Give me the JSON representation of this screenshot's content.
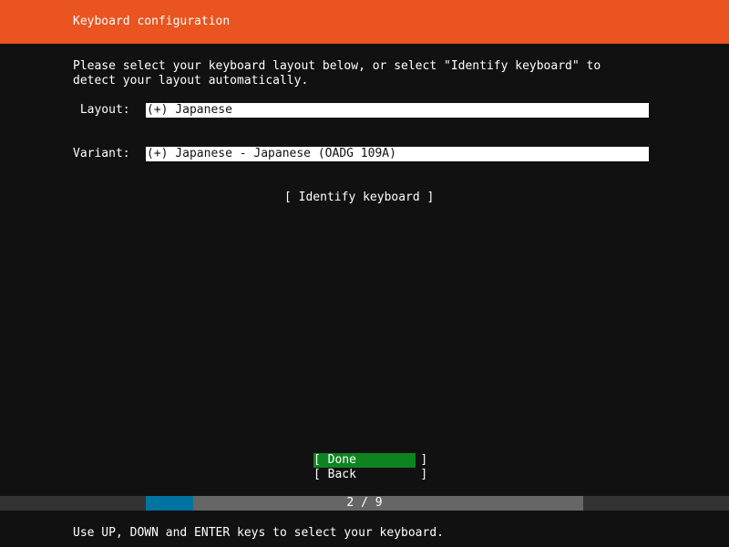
{
  "header": {
    "title": "Keyboard configuration"
  },
  "main": {
    "description_line1": "Please select your keyboard layout below, or select \"Identify keyboard\" to",
    "description_line2": "detect your layout automatically.",
    "layout_label": " Layout:",
    "layout_value": "(+) Japanese",
    "variant_label": "Variant:",
    "variant_value": "(+) Japanese - Japanese (OADG 109A)",
    "identify_button": "[ Identify keyboard ]"
  },
  "buttons": {
    "done_label": "[ Done         ]",
    "back_label": "[ Back         ]"
  },
  "progress": {
    "text": "2 / 9",
    "current": 2,
    "total": 9
  },
  "footer": {
    "help_text": "Use UP, DOWN and ENTER keys to select your keyboard."
  },
  "colors": {
    "header_bg": "#e95420",
    "background": "#111111",
    "done_bg": "#0e8420",
    "progress_fill": "#0073a0",
    "progress_track": "#666666",
    "status_bar": "#333333"
  }
}
